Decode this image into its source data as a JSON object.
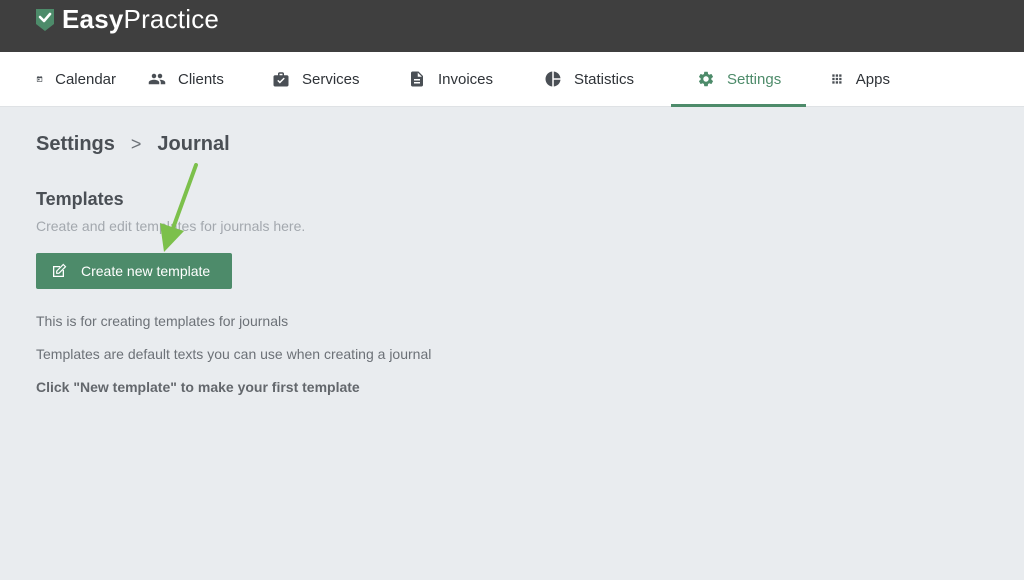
{
  "brand": {
    "name_bold": "Easy",
    "name_light": "Practice"
  },
  "nav": {
    "items": [
      {
        "label": "Calendar",
        "icon": "calendar-icon"
      },
      {
        "label": "Clients",
        "icon": "people-icon"
      },
      {
        "label": "Services",
        "icon": "briefcase-icon"
      },
      {
        "label": "Invoices",
        "icon": "document-icon"
      },
      {
        "label": "Statistics",
        "icon": "pie-chart-icon"
      },
      {
        "label": "Settings",
        "icon": "gear-icon"
      },
      {
        "label": "Apps",
        "icon": "grid-icon"
      }
    ],
    "active": "Settings"
  },
  "breadcrumb": {
    "root": "Settings",
    "separator": ">",
    "current": "Journal"
  },
  "templates": {
    "title": "Templates",
    "description": "Create and edit templates for journals here.",
    "create_button": "Create new template",
    "info_line_1": "This is for creating templates for journals",
    "info_line_2": "Templates are default texts you can use when creating a journal",
    "info_line_3": "Click \"New template\" to make your first template"
  },
  "colors": {
    "accent": "#4d8b6a",
    "topbar": "#3f3f3f",
    "background": "#e9ecef",
    "arrow": "#7cc04b"
  }
}
